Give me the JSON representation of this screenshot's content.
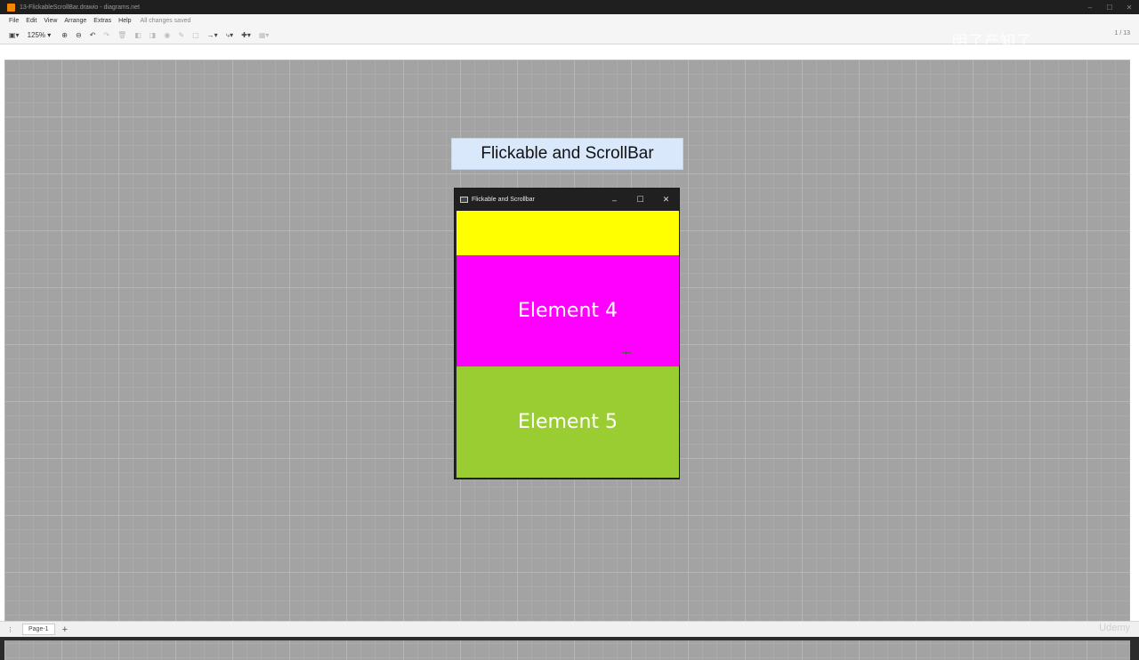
{
  "os_window": {
    "title": "13-FlickableScrollBar.drawio - diagrams.net",
    "icons": [
      "drawio-logo-icon",
      "minimize-icon",
      "maximize-icon",
      "close-icon"
    ]
  },
  "menu": {
    "items": [
      "File",
      "Edit",
      "View",
      "Arrange",
      "Extras",
      "Help"
    ],
    "status": "All changes saved"
  },
  "toolbar": {
    "zoom": "125%",
    "page_indicator": "1 / 13",
    "watermark": "明了产知了"
  },
  "diagram": {
    "title": "Flickable and ScrollBar",
    "title_box_color": "#dae8fc"
  },
  "app_window": {
    "title": "Flickable and Scrollbar",
    "elements": [
      {
        "label": "",
        "color": "#ffff00"
      },
      {
        "label": "Element 4",
        "color": "#ff00ff"
      },
      {
        "label": "Element 5",
        "color": "#9acd32"
      }
    ]
  },
  "statusbar": {
    "page_tab": "Page-1",
    "add_page": "+",
    "brand": "Udemy"
  }
}
